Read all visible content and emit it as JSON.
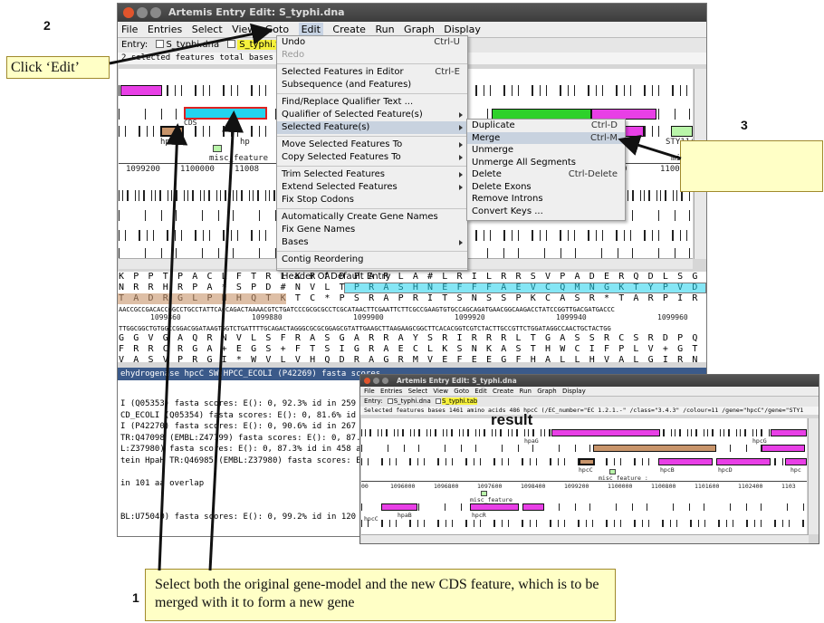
{
  "window": {
    "title": "Artemis Entry Edit: S_typhi.dna",
    "menus": [
      "File",
      "Entries",
      "Select",
      "View",
      "Goto",
      "Edit",
      "Create",
      "Run",
      "Graph",
      "Display"
    ],
    "entry_label": "Entry:",
    "entries": [
      "S_typhi.dna",
      "S_typhi.tab"
    ],
    "status": "2 selected features  total bases 1"
  },
  "feature_view": {
    "labels": {
      "cds": "CDS",
      "hpc1": "hpc",
      "hpc2": "hp",
      "misc1": "misc_feature",
      "misc2": "misc",
      "sty": "STY1143"
    },
    "coords": [
      "1099200",
      "1100000",
      "11008",
      "0",
      "1100"
    ]
  },
  "edit_menu": {
    "items": [
      {
        "label": "Undo",
        "accel": "Ctrl-U"
      },
      {
        "label": "Redo",
        "accel": "",
        "disabled": true
      },
      {
        "sep": true
      },
      {
        "label": "Selected Features in Editor",
        "accel": "Ctrl-E"
      },
      {
        "label": "Subsequence (and Features)",
        "accel": ""
      },
      {
        "sep": true
      },
      {
        "label": "Find/Replace Qualifier Text ...",
        "accel": ""
      },
      {
        "label": "Qualifier of Selected Feature(s)",
        "accel": "",
        "sub": true
      },
      {
        "label": "Selected Feature(s)",
        "accel": "",
        "sub": true,
        "highlight": true
      },
      {
        "sep": true
      },
      {
        "label": "Move Selected Features To",
        "accel": "",
        "sub": true
      },
      {
        "label": "Copy Selected Features To",
        "accel": "",
        "sub": true
      },
      {
        "sep": true
      },
      {
        "label": "Trim Selected Features",
        "accel": "",
        "sub": true
      },
      {
        "label": "Extend Selected Features",
        "accel": "",
        "sub": true
      },
      {
        "label": "Fix Stop Codons",
        "accel": ""
      },
      {
        "sep": true
      },
      {
        "label": "Automatically Create Gene Names",
        "accel": ""
      },
      {
        "label": "Fix Gene Names",
        "accel": ""
      },
      {
        "label": "Bases",
        "accel": "",
        "sub": true
      },
      {
        "sep": true
      },
      {
        "label": "Contig Reordering",
        "accel": ""
      },
      {
        "sep": true
      },
      {
        "label": "Header Of Default Entry",
        "accel": ""
      }
    ]
  },
  "submenu": {
    "items": [
      {
        "label": "Duplicate",
        "accel": "Ctrl-D"
      },
      {
        "label": "Merge",
        "accel": "Ctrl-M",
        "highlight": true
      },
      {
        "label": "Unmerge",
        "accel": ""
      },
      {
        "label": "Unmerge All Segments",
        "accel": ""
      },
      {
        "label": "Delete",
        "accel": "Ctrl-Delete"
      },
      {
        "label": "Delete Exons",
        "accel": ""
      },
      {
        "label": "Remove Introns",
        "accel": ""
      },
      {
        "label": "Convert Keys ...",
        "accel": ""
      }
    ]
  },
  "sequence": {
    "aa1": "K P P T P A C L F T R L K R A D P A R L A # L R I L R R S V P A D E R Q D L S G * R",
    "aa2": "N R R H R P A * S P D # N V L T P R A S H N E F F F A E V C Q M N G K T Y P V D D",
    "aa3": "T A D R G L P H H Q T K T C * P S R A P R I T S N S S P K C A S R * T A R P I R L T I",
    "dna_fwd": "AACCGCCGACACCGGCCTGCCTATTCACCAGACTAAAACGTCTGATCCCGCGCGCCTCGCATAACTTCGAATTCTTCGCCGAAGTGTGCCAGCAGATGAACGGCAAGACCTATCCGGTTGACGATGACCC",
    "ticks": [
      "1099860",
      "1099880",
      "1099900",
      "1099920",
      "1099940",
      "1099960"
    ],
    "dna_rev": "TTGGCGGCTGTGGCCGGACGGATAAGTGGTCTGATTTTGCAGACTAGGGCGCGCGGAGCGTATTGAAGCTTAAGAAGCGGCTTCACACGGTCGTCTACTTGCCGTTCTGGATAGGCCAACTGCTACTGG",
    "aa4": "G G V G A Q R N V L S F R A S G A R R A Y S R I R R R L T G A S S R C S R D P Q R Y",
    "aa5": "F R R C R G A + E G S + F T S I G R A E C L K S N K A S T H W C I F P L V + G T S S",
    "aa6": "V A S V P R G I * W V L V H Q D R A G R M V E F E E G F H A L L H V A L G I R N V I"
  },
  "blast": {
    "header": "ehydrogenase hpcC SW:HPCC_ECOLI (P42269) fasta scores",
    "lines": [
      "I (Q05353) fasta scores: E(): 0, 92.3% id in 259 aa",
      "CD_ECOLI (Q05354) fasta scores: E(): 0, 81.6% id in 1",
      "I (P42270) fasta scores: E(): 0, 90.6% id in 267 aa",
      "TR:Q47098 (EMBL:Z47799) fasta scores: E(): 0, 87.8%",
      "L:Z37980) fasta scores: E(): 0, 87.3% id in 458 aa",
      "tein HpaH TR:Q46985 (EMBL:Z37980) fasta scores: E():",
      "",
      "in 101 aa overlap",
      "",
      "",
      "BL:U75040) fasta scores: E(): 0, 99.2% id in 120 aa"
    ]
  },
  "annotations": {
    "n1": "1",
    "n2": "2",
    "n3": "3",
    "click_edit": "Click ‘Edit’",
    "step1": "Select both the original gene-model and the new CDS feature, which is to be merged with it to form a new gene"
  },
  "result": {
    "title": "Artemis Entry Edit: S_typhi.dna",
    "menus": [
      "File",
      "Entries",
      "Select",
      "View",
      "Goto",
      "Edit",
      "Create",
      "Run",
      "Graph",
      "Display"
    ],
    "entry_label": "Entry:",
    "entries": [
      "S_typhi.dna",
      "S_typhi.tab"
    ],
    "status": "Selected features  bases 1461  amino acids 486  hpcC  (/EC_number=\"EC 1.2.1.-\" /class=\"3.4.3\" /colour=11 /gene=\"hpcC\"/gene=\"STY1",
    "heading": "result",
    "labels": {
      "hpaG": "hpaG",
      "hpcG": "hpcG",
      "hpcC": "hpcC",
      "hpcB": "hpcB",
      "hpcD": "hpcD",
      "hpcE": "hpc",
      "misc1": "misc_feature :",
      "misc2": "misc_feature",
      "hpaB": "hpaB",
      "hpcR": "hpcR",
      "hpcC2": "hpcC"
    },
    "coords": [
      "00",
      "1096000",
      "1096800",
      "1097600",
      "1098400",
      "1099200",
      "1100000",
      "1100800",
      "1101600",
      "1102400",
      "1103"
    ]
  },
  "colors": {
    "magenta": "#e83fe6",
    "cyan": "#22d3ee",
    "green": "#2ed12a",
    "tan": "#c8946a",
    "yellow_sel": "#f6f13c",
    "callout": "#ffffc6"
  }
}
